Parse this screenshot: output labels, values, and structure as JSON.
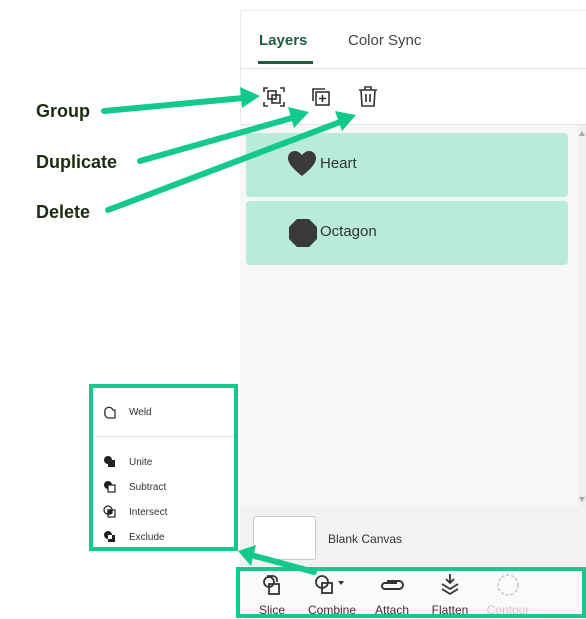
{
  "tabs": {
    "layers": "Layers",
    "color_sync": "Color Sync"
  },
  "toolbar": {
    "group_icon": "group-icon",
    "duplicate_icon": "duplicate-icon",
    "delete_icon": "trash-icon"
  },
  "layers": [
    {
      "name": "Heart",
      "icon": "heart-icon"
    },
    {
      "name": "Octagon",
      "icon": "octagon-icon"
    }
  ],
  "canvas": {
    "label": "Blank Canvas"
  },
  "bottom_tools": [
    {
      "label": "Slice",
      "enabled": true
    },
    {
      "label": "Combine",
      "enabled": true
    },
    {
      "label": "Attach",
      "enabled": true
    },
    {
      "label": "Flatten",
      "enabled": true
    },
    {
      "label": "Contour",
      "enabled": false
    }
  ],
  "combine_menu": {
    "weld": "Weld",
    "unite": "Unite",
    "subtract": "Subtract",
    "intersect": "Intersect",
    "exclude": "Exclude"
  },
  "annotations": {
    "group": "Group",
    "duplicate": "Duplicate",
    "delete": "Delete"
  },
  "colors": {
    "accent": "#14c98c",
    "layer_bg": "#b8ebdb",
    "tab_active": "#1f5d40",
    "annotation_text": "#1d2c10"
  }
}
